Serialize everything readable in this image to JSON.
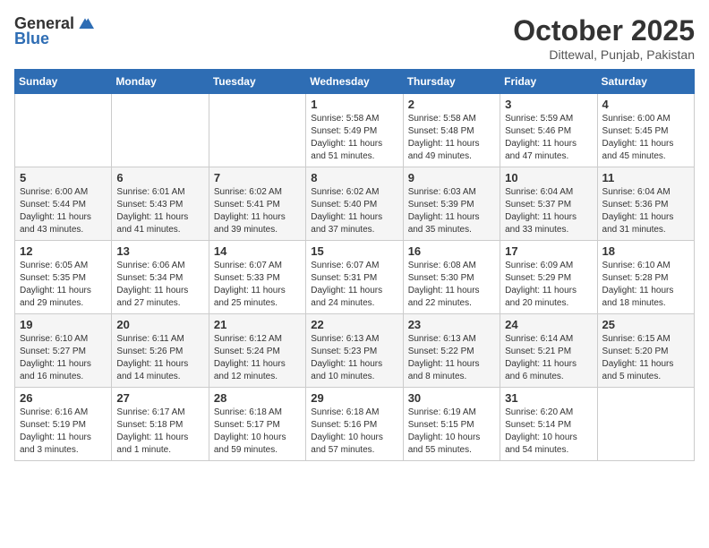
{
  "header": {
    "logo_general": "General",
    "logo_blue": "Blue",
    "month_title": "October 2025",
    "location": "Dittewal, Punjab, Pakistan"
  },
  "days_of_week": [
    "Sunday",
    "Monday",
    "Tuesday",
    "Wednesday",
    "Thursday",
    "Friday",
    "Saturday"
  ],
  "weeks": [
    [
      {
        "day": "",
        "info": ""
      },
      {
        "day": "",
        "info": ""
      },
      {
        "day": "",
        "info": ""
      },
      {
        "day": "1",
        "info": "Sunrise: 5:58 AM\nSunset: 5:49 PM\nDaylight: 11 hours and 51 minutes."
      },
      {
        "day": "2",
        "info": "Sunrise: 5:58 AM\nSunset: 5:48 PM\nDaylight: 11 hours and 49 minutes."
      },
      {
        "day": "3",
        "info": "Sunrise: 5:59 AM\nSunset: 5:46 PM\nDaylight: 11 hours and 47 minutes."
      },
      {
        "day": "4",
        "info": "Sunrise: 6:00 AM\nSunset: 5:45 PM\nDaylight: 11 hours and 45 minutes."
      }
    ],
    [
      {
        "day": "5",
        "info": "Sunrise: 6:00 AM\nSunset: 5:44 PM\nDaylight: 11 hours and 43 minutes."
      },
      {
        "day": "6",
        "info": "Sunrise: 6:01 AM\nSunset: 5:43 PM\nDaylight: 11 hours and 41 minutes."
      },
      {
        "day": "7",
        "info": "Sunrise: 6:02 AM\nSunset: 5:41 PM\nDaylight: 11 hours and 39 minutes."
      },
      {
        "day": "8",
        "info": "Sunrise: 6:02 AM\nSunset: 5:40 PM\nDaylight: 11 hours and 37 minutes."
      },
      {
        "day": "9",
        "info": "Sunrise: 6:03 AM\nSunset: 5:39 PM\nDaylight: 11 hours and 35 minutes."
      },
      {
        "day": "10",
        "info": "Sunrise: 6:04 AM\nSunset: 5:37 PM\nDaylight: 11 hours and 33 minutes."
      },
      {
        "day": "11",
        "info": "Sunrise: 6:04 AM\nSunset: 5:36 PM\nDaylight: 11 hours and 31 minutes."
      }
    ],
    [
      {
        "day": "12",
        "info": "Sunrise: 6:05 AM\nSunset: 5:35 PM\nDaylight: 11 hours and 29 minutes."
      },
      {
        "day": "13",
        "info": "Sunrise: 6:06 AM\nSunset: 5:34 PM\nDaylight: 11 hours and 27 minutes."
      },
      {
        "day": "14",
        "info": "Sunrise: 6:07 AM\nSunset: 5:33 PM\nDaylight: 11 hours and 25 minutes."
      },
      {
        "day": "15",
        "info": "Sunrise: 6:07 AM\nSunset: 5:31 PM\nDaylight: 11 hours and 24 minutes."
      },
      {
        "day": "16",
        "info": "Sunrise: 6:08 AM\nSunset: 5:30 PM\nDaylight: 11 hours and 22 minutes."
      },
      {
        "day": "17",
        "info": "Sunrise: 6:09 AM\nSunset: 5:29 PM\nDaylight: 11 hours and 20 minutes."
      },
      {
        "day": "18",
        "info": "Sunrise: 6:10 AM\nSunset: 5:28 PM\nDaylight: 11 hours and 18 minutes."
      }
    ],
    [
      {
        "day": "19",
        "info": "Sunrise: 6:10 AM\nSunset: 5:27 PM\nDaylight: 11 hours and 16 minutes."
      },
      {
        "day": "20",
        "info": "Sunrise: 6:11 AM\nSunset: 5:26 PM\nDaylight: 11 hours and 14 minutes."
      },
      {
        "day": "21",
        "info": "Sunrise: 6:12 AM\nSunset: 5:24 PM\nDaylight: 11 hours and 12 minutes."
      },
      {
        "day": "22",
        "info": "Sunrise: 6:13 AM\nSunset: 5:23 PM\nDaylight: 11 hours and 10 minutes."
      },
      {
        "day": "23",
        "info": "Sunrise: 6:13 AM\nSunset: 5:22 PM\nDaylight: 11 hours and 8 minutes."
      },
      {
        "day": "24",
        "info": "Sunrise: 6:14 AM\nSunset: 5:21 PM\nDaylight: 11 hours and 6 minutes."
      },
      {
        "day": "25",
        "info": "Sunrise: 6:15 AM\nSunset: 5:20 PM\nDaylight: 11 hours and 5 minutes."
      }
    ],
    [
      {
        "day": "26",
        "info": "Sunrise: 6:16 AM\nSunset: 5:19 PM\nDaylight: 11 hours and 3 minutes."
      },
      {
        "day": "27",
        "info": "Sunrise: 6:17 AM\nSunset: 5:18 PM\nDaylight: 11 hours and 1 minute."
      },
      {
        "day": "28",
        "info": "Sunrise: 6:18 AM\nSunset: 5:17 PM\nDaylight: 10 hours and 59 minutes."
      },
      {
        "day": "29",
        "info": "Sunrise: 6:18 AM\nSunset: 5:16 PM\nDaylight: 10 hours and 57 minutes."
      },
      {
        "day": "30",
        "info": "Sunrise: 6:19 AM\nSunset: 5:15 PM\nDaylight: 10 hours and 55 minutes."
      },
      {
        "day": "31",
        "info": "Sunrise: 6:20 AM\nSunset: 5:14 PM\nDaylight: 10 hours and 54 minutes."
      },
      {
        "day": "",
        "info": ""
      }
    ]
  ]
}
